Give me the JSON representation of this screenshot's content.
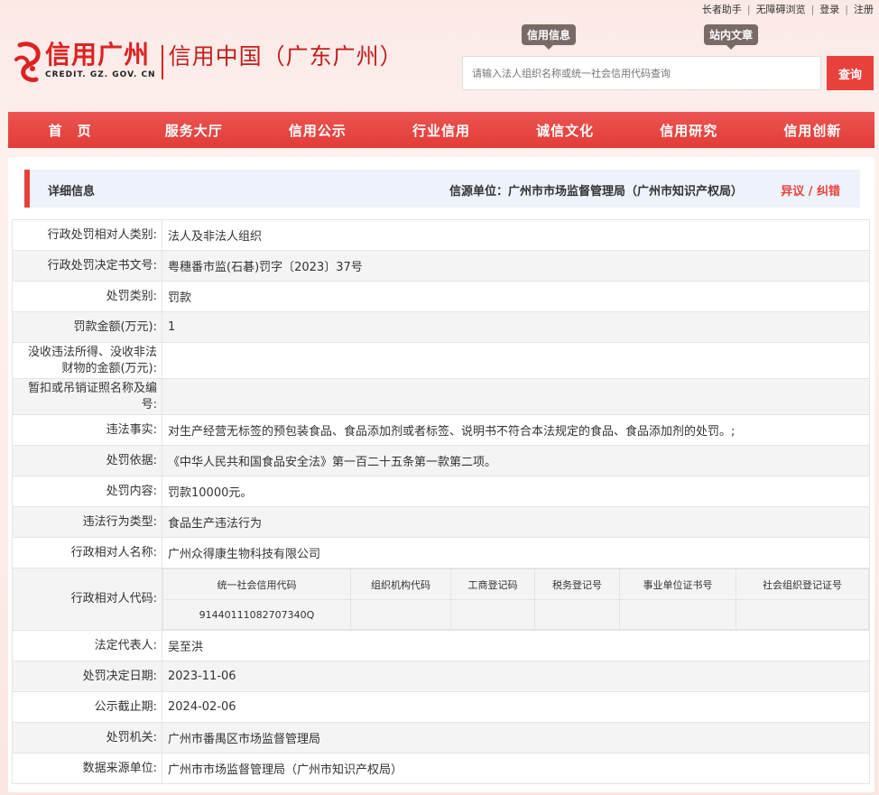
{
  "topbar": {
    "elder": "长者助手",
    "access": "无障碍浏览",
    "login": "登录",
    "register": "注册",
    "sep": "|"
  },
  "header": {
    "logo_main": "信用广州",
    "logo_sub": "CREDIT. GZ. GOV. CN",
    "logo_right": "信用中国（广东广州）",
    "tag_info": "信用信息",
    "tag_article": "站内文章",
    "search_placeholder": "请输入法人组织名称或统一社会信用代码查询",
    "search_button": "查询"
  },
  "nav": [
    "首　页",
    "服务大厅",
    "信用公示",
    "行业信用",
    "诚信文化",
    "信用研究",
    "信用创新"
  ],
  "detail": {
    "title": "详细信息",
    "source": "信源单位：广州市市场监督管理局（广州市知识产权局）",
    "objection": "异议 / 纠错"
  },
  "rows": [
    {
      "label": "行政处罚相对人类别:",
      "value": "法人及非法人组织"
    },
    {
      "label": "行政处罚决定书文号:",
      "value": "粤穗番市监(石碁)罚字〔2023〕37号"
    },
    {
      "label": "处罚类别:",
      "value": "罚款"
    },
    {
      "label": "罚款金额(万元):",
      "value": "1"
    },
    {
      "label": "没收违法所得、没收非法财物的金额(万元):",
      "value": ""
    },
    {
      "label": "暂扣或吊销证照名称及编号:",
      "value": ""
    },
    {
      "label": "违法事实:",
      "value": "对生产经营无标签的预包装食品、食品添加剂或者标签、说明书不符合本法规定的食品、食品添加剂的处罚。;"
    },
    {
      "label": "处罚依据:",
      "value": "《中华人民共和国食品安全法》第一百二十五条第一款第二项。"
    },
    {
      "label": "处罚内容:",
      "value": "罚款10000元。"
    },
    {
      "label": "违法行为类型:",
      "value": "食品生产违法行为"
    },
    {
      "label": "行政相对人名称:",
      "value": "广州众得康生物科技有限公司"
    }
  ],
  "code_row": {
    "label": "行政相对人代码:",
    "headers": [
      "统一社会信用代码",
      "组织机构代码",
      "工商登记码",
      "税务登记号",
      "事业单位证书号",
      "社会组织登记证号"
    ],
    "values": [
      "91440111082707340Q",
      "",
      "",
      "",
      "",
      ""
    ]
  },
  "rows_after": [
    {
      "label": "法定代表人:",
      "value": "吴至洪"
    },
    {
      "label": "处罚决定日期:",
      "value": "2023-11-06"
    },
    {
      "label": "公示截止期:",
      "value": "2024-02-06"
    },
    {
      "label": "处罚机关:",
      "value": "广州市番禺区市场监督管理局"
    },
    {
      "label": "数据来源单位:",
      "value": "广州市市场监督管理局（广州市知识产权局）"
    }
  ]
}
